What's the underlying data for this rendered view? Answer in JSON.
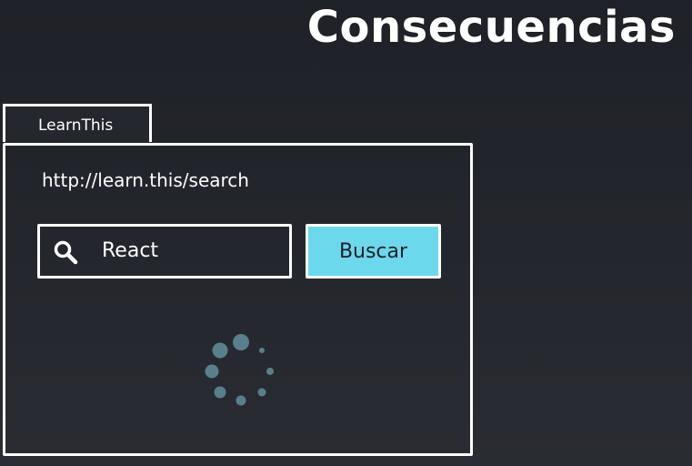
{
  "slide": {
    "title": "Consecuencias"
  },
  "browser": {
    "tab_label": "LearnThis",
    "url": "http://learn.this/search"
  },
  "search": {
    "icon": "search-icon",
    "value": "React",
    "button_label": "Buscar"
  },
  "status": {
    "icon": "loading-spinner-icon"
  },
  "colors": {
    "accent": "#6cd8ec",
    "spinner": "#5a7f8c",
    "background": "#23252c"
  }
}
